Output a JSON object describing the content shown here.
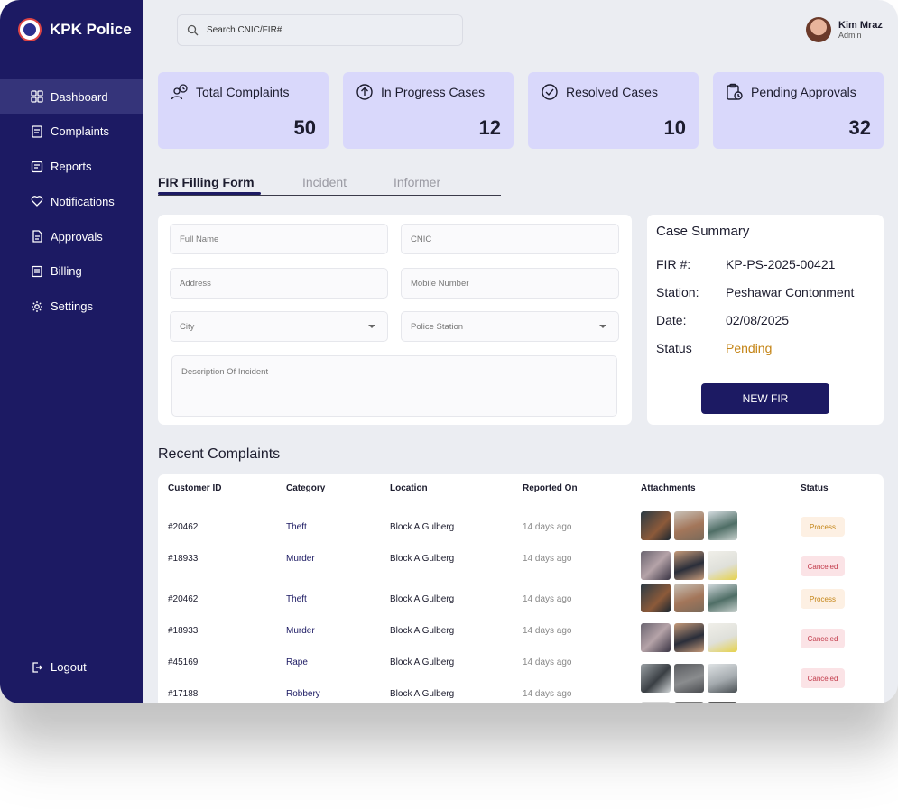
{
  "brand": {
    "name": "KPK Police"
  },
  "sidebar": {
    "items": [
      {
        "label": "Dashboard",
        "icon": "grid-icon"
      },
      {
        "label": "Complaints",
        "icon": "document-icon"
      },
      {
        "label": "Reports",
        "icon": "report-icon"
      },
      {
        "label": "Notifications",
        "icon": "heart-icon"
      },
      {
        "label": "Approvals",
        "icon": "file-icon"
      },
      {
        "label": "Billing",
        "icon": "receipt-icon"
      },
      {
        "label": "Settings",
        "icon": "gear-icon"
      }
    ],
    "logout": "Logout"
  },
  "search": {
    "placeholder": "Search CNIC/FIR#"
  },
  "user": {
    "name": "Kim Mraz",
    "role": "Admin"
  },
  "stats": [
    {
      "title": "Total Complaints",
      "value": "50",
      "icon": "user-clock-icon"
    },
    {
      "title": "In Progress Cases",
      "value": "12",
      "icon": "upload-circle-icon"
    },
    {
      "title": "Resolved Cases",
      "value": "10",
      "icon": "check-badge-icon"
    },
    {
      "title": "Pending Approvals",
      "value": "32",
      "icon": "clipboard-clock-icon"
    }
  ],
  "tabs": [
    {
      "label": "FIR Filling Form",
      "active": true
    },
    {
      "label": "Incident",
      "active": false
    },
    {
      "label": "Informer",
      "active": false
    }
  ],
  "form": {
    "full_name": "Full Name",
    "cnic": "CNIC",
    "address": "Address",
    "mobile": "Mobile Number",
    "city": "City",
    "police_station": "Police Station",
    "description": "Description Of Incident"
  },
  "summary": {
    "title": "Case Summary",
    "fir_label": "FIR #:",
    "fir_value": "KP-PS-2025-00421",
    "station_label": "Station:",
    "station_value": "Peshawar Contonment",
    "date_label": "Date:",
    "date_value": "02/08/2025",
    "status_label": "Status",
    "status_value": "Pending",
    "button": "NEW FIR"
  },
  "recent": {
    "title": "Recent Complaints",
    "columns": [
      "Customer ID",
      "Category",
      "Location",
      "Reported On",
      "Attachments",
      "Status"
    ],
    "rows": [
      {
        "id": "#20462",
        "category": "Theft",
        "location": "Block A Gulberg",
        "reported": "14 days ago",
        "status": "Process"
      },
      {
        "id": "#18933",
        "category": "Murder",
        "location": "Block A Gulberg",
        "reported": "14 days ago",
        "status": "Canceled"
      },
      {
        "id": "#20462",
        "category": "Theft",
        "location": "Block A Gulberg",
        "reported": "14 days ago",
        "status": "Process"
      },
      {
        "id": "#18933",
        "category": "Murder",
        "location": "Block A Gulberg",
        "reported": "14 days ago",
        "status": "Canceled"
      },
      {
        "id": "#45169",
        "category": "Rape",
        "location": "Block A Gulberg",
        "reported": "14 days ago",
        "status": "Canceled"
      },
      {
        "id": "#17188",
        "category": "Robbery",
        "location": "Block A Gulberg",
        "reported": "14 days ago",
        "status": ""
      }
    ]
  },
  "colors": {
    "sidebar": "#1c1a63",
    "card": "#d9d8fb",
    "pending": "#c48415",
    "canceled": "#c23a4a"
  }
}
